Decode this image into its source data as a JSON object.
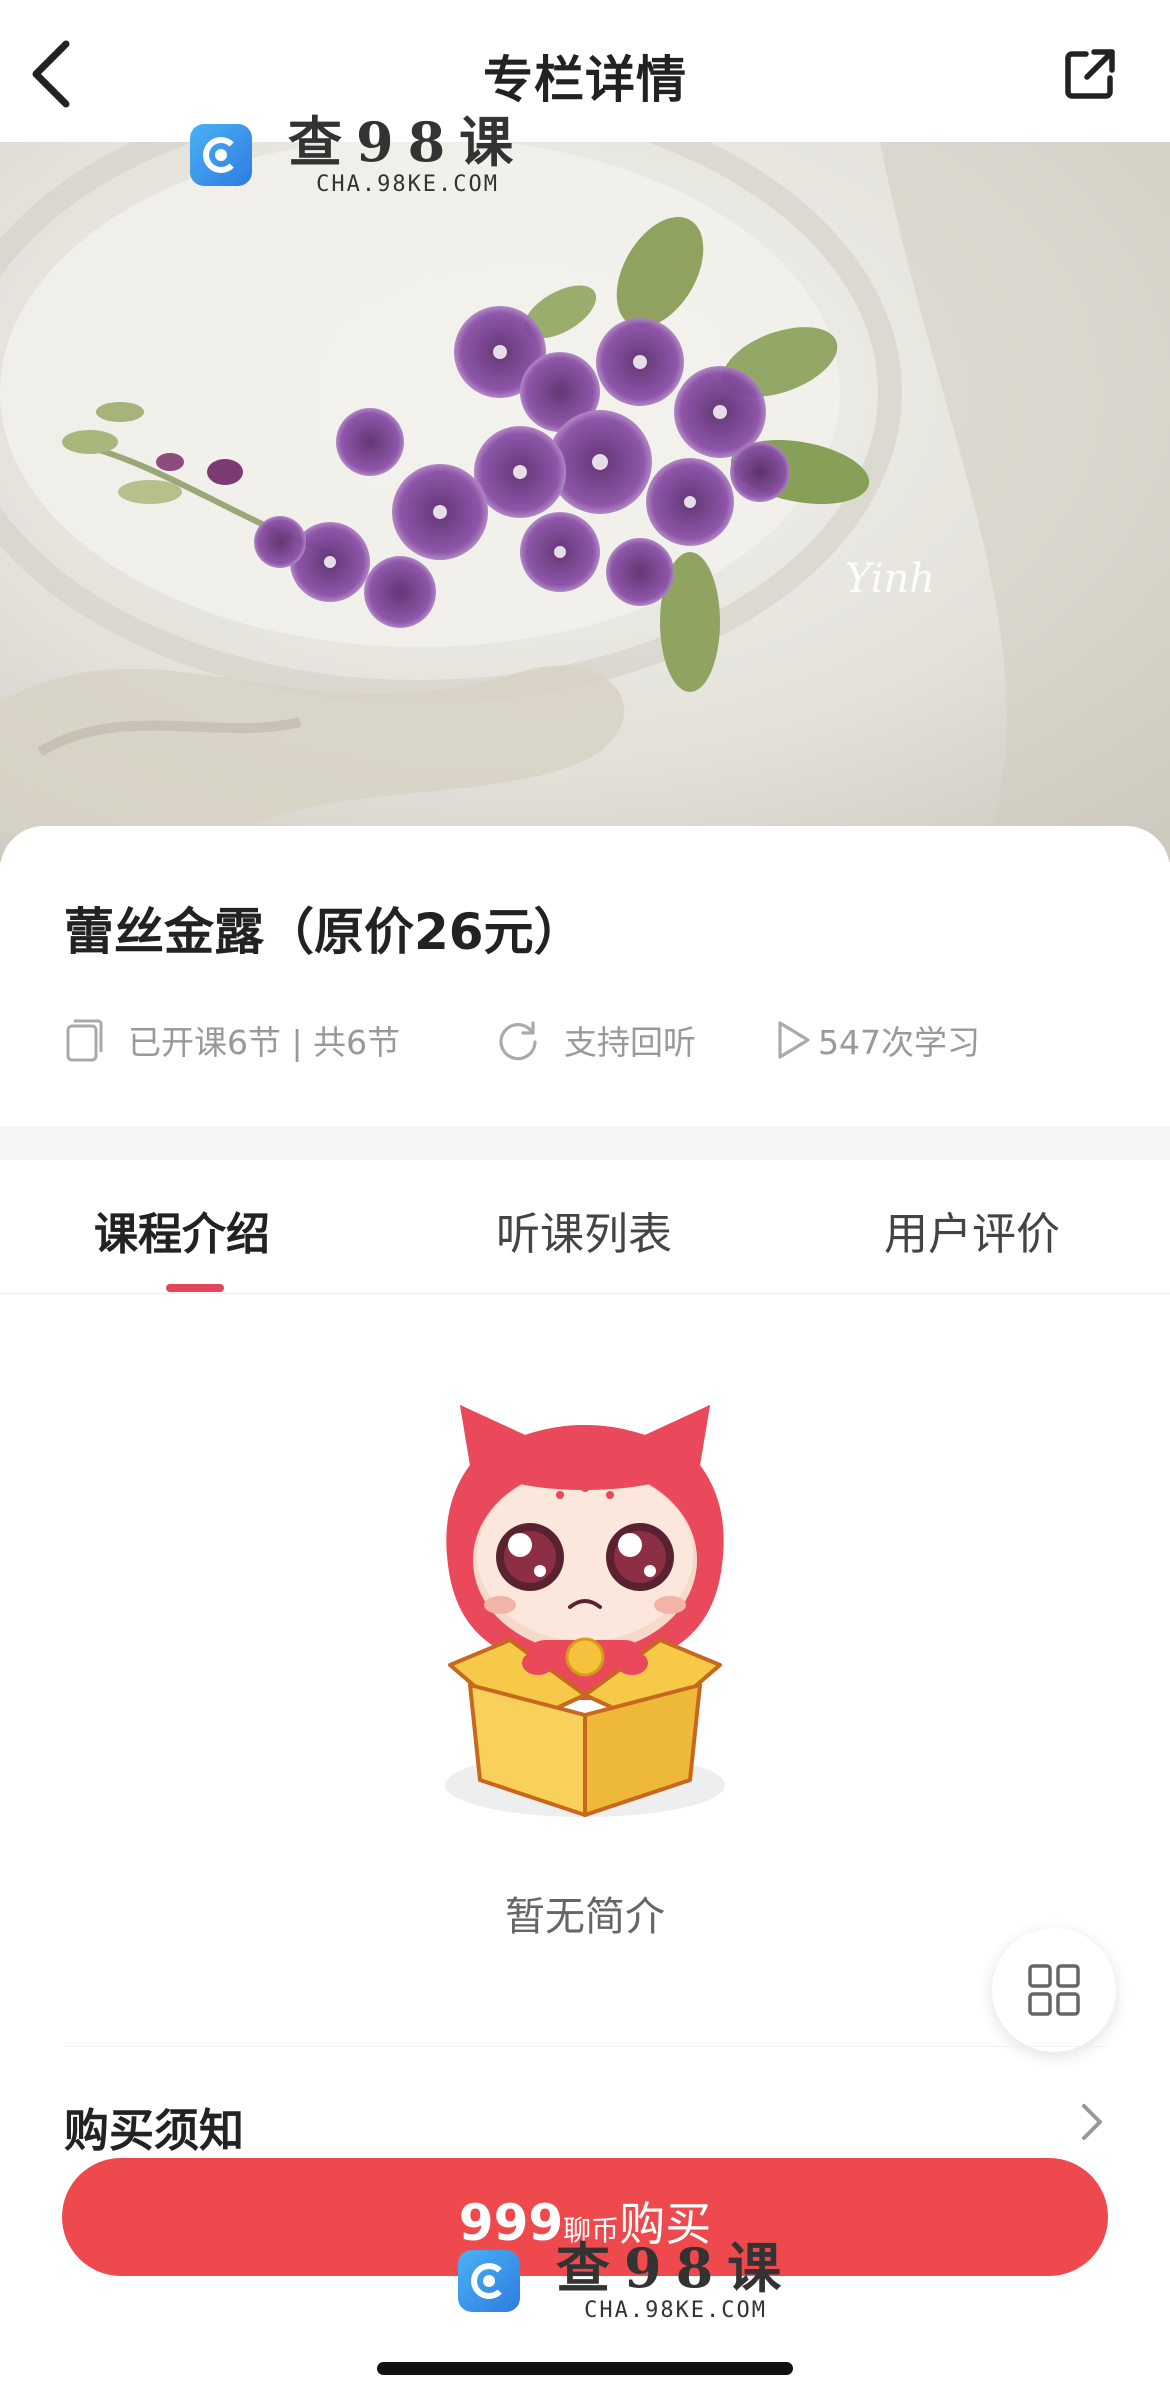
{
  "nav": {
    "title": "专栏详情",
    "back_icon": "chevron-left-icon",
    "share_icon": "share-external-icon"
  },
  "watermark": {
    "cn": "查98课",
    "en": "CHA.98KE.COM"
  },
  "hero": {
    "signature": "Yinh"
  },
  "course": {
    "title": "蕾丝金露（原价26元）",
    "lessons": "已开课6节 | 共6节",
    "replay": "支持回听",
    "learners": "547次学习"
  },
  "tabs": [
    {
      "label": "课程介绍",
      "active": true
    },
    {
      "label": "听课列表",
      "active": false
    },
    {
      "label": "用户评价",
      "active": false
    }
  ],
  "empty": {
    "text": "暂无简介"
  },
  "notice": {
    "title": "购买须知"
  },
  "buy": {
    "price": "999",
    "unit": "聊币",
    "label": "购买"
  },
  "colors": {
    "accent": "#e3465a",
    "buy_button": "#ee4a4d",
    "muted_text": "#999999"
  }
}
